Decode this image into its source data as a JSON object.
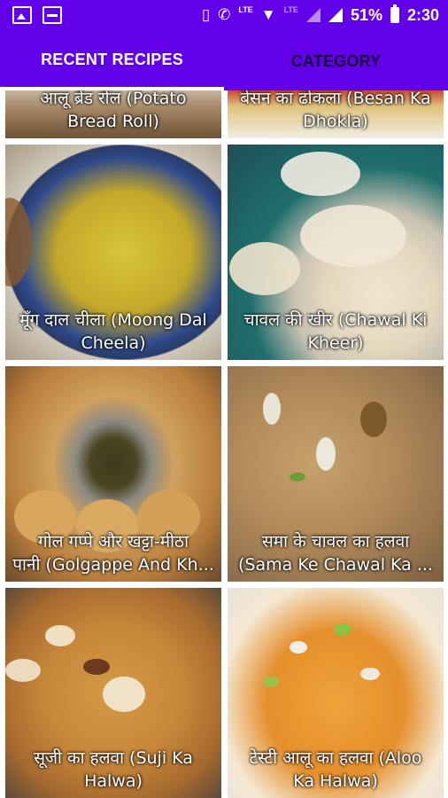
{
  "status_bar": {
    "time": "2:30",
    "battery_percent": "51%",
    "network_label": "LTE",
    "icons": [
      "image-icon",
      "pulse-icon",
      "vibrate-icon",
      "wifi-calling-icon",
      "wifi-icon",
      "signal-icon",
      "battery-icon"
    ]
  },
  "tabs": [
    {
      "label": "RECENT RECIPES",
      "active": true
    },
    {
      "label": "CATEGORY",
      "active": false
    }
  ],
  "colors": {
    "primary": "#6200ea",
    "tab_inactive_text": "#1a0a3a"
  },
  "recipes": [
    {
      "line1": "आलू ब्रेड रोल (Potato",
      "line2": "Bread Roll)"
    },
    {
      "line1": "बेसन का ढोकला (Besan Ka",
      "line2": "Dhokla)"
    },
    {
      "line1": "मूँग दाल चीला (Moong Dal",
      "line2": "Cheela)"
    },
    {
      "line1": "चावल की खीर (Chawal Ki",
      "line2": "Kheer)"
    },
    {
      "line1": "गोल गप्पे और खट्टा-मीठा",
      "line2": "पानी (Golgappe And Kh..."
    },
    {
      "line1": "समा के चावल का हलवा",
      "line2": "(Sama Ke Chawal Ka ..."
    },
    {
      "line1": "सूजी का हलवा (Suji Ka",
      "line2": "Halwa)"
    },
    {
      "line1": "टेस्टी आलू का हलवा (Aloo",
      "line2": "Ka Halwa)"
    }
  ]
}
